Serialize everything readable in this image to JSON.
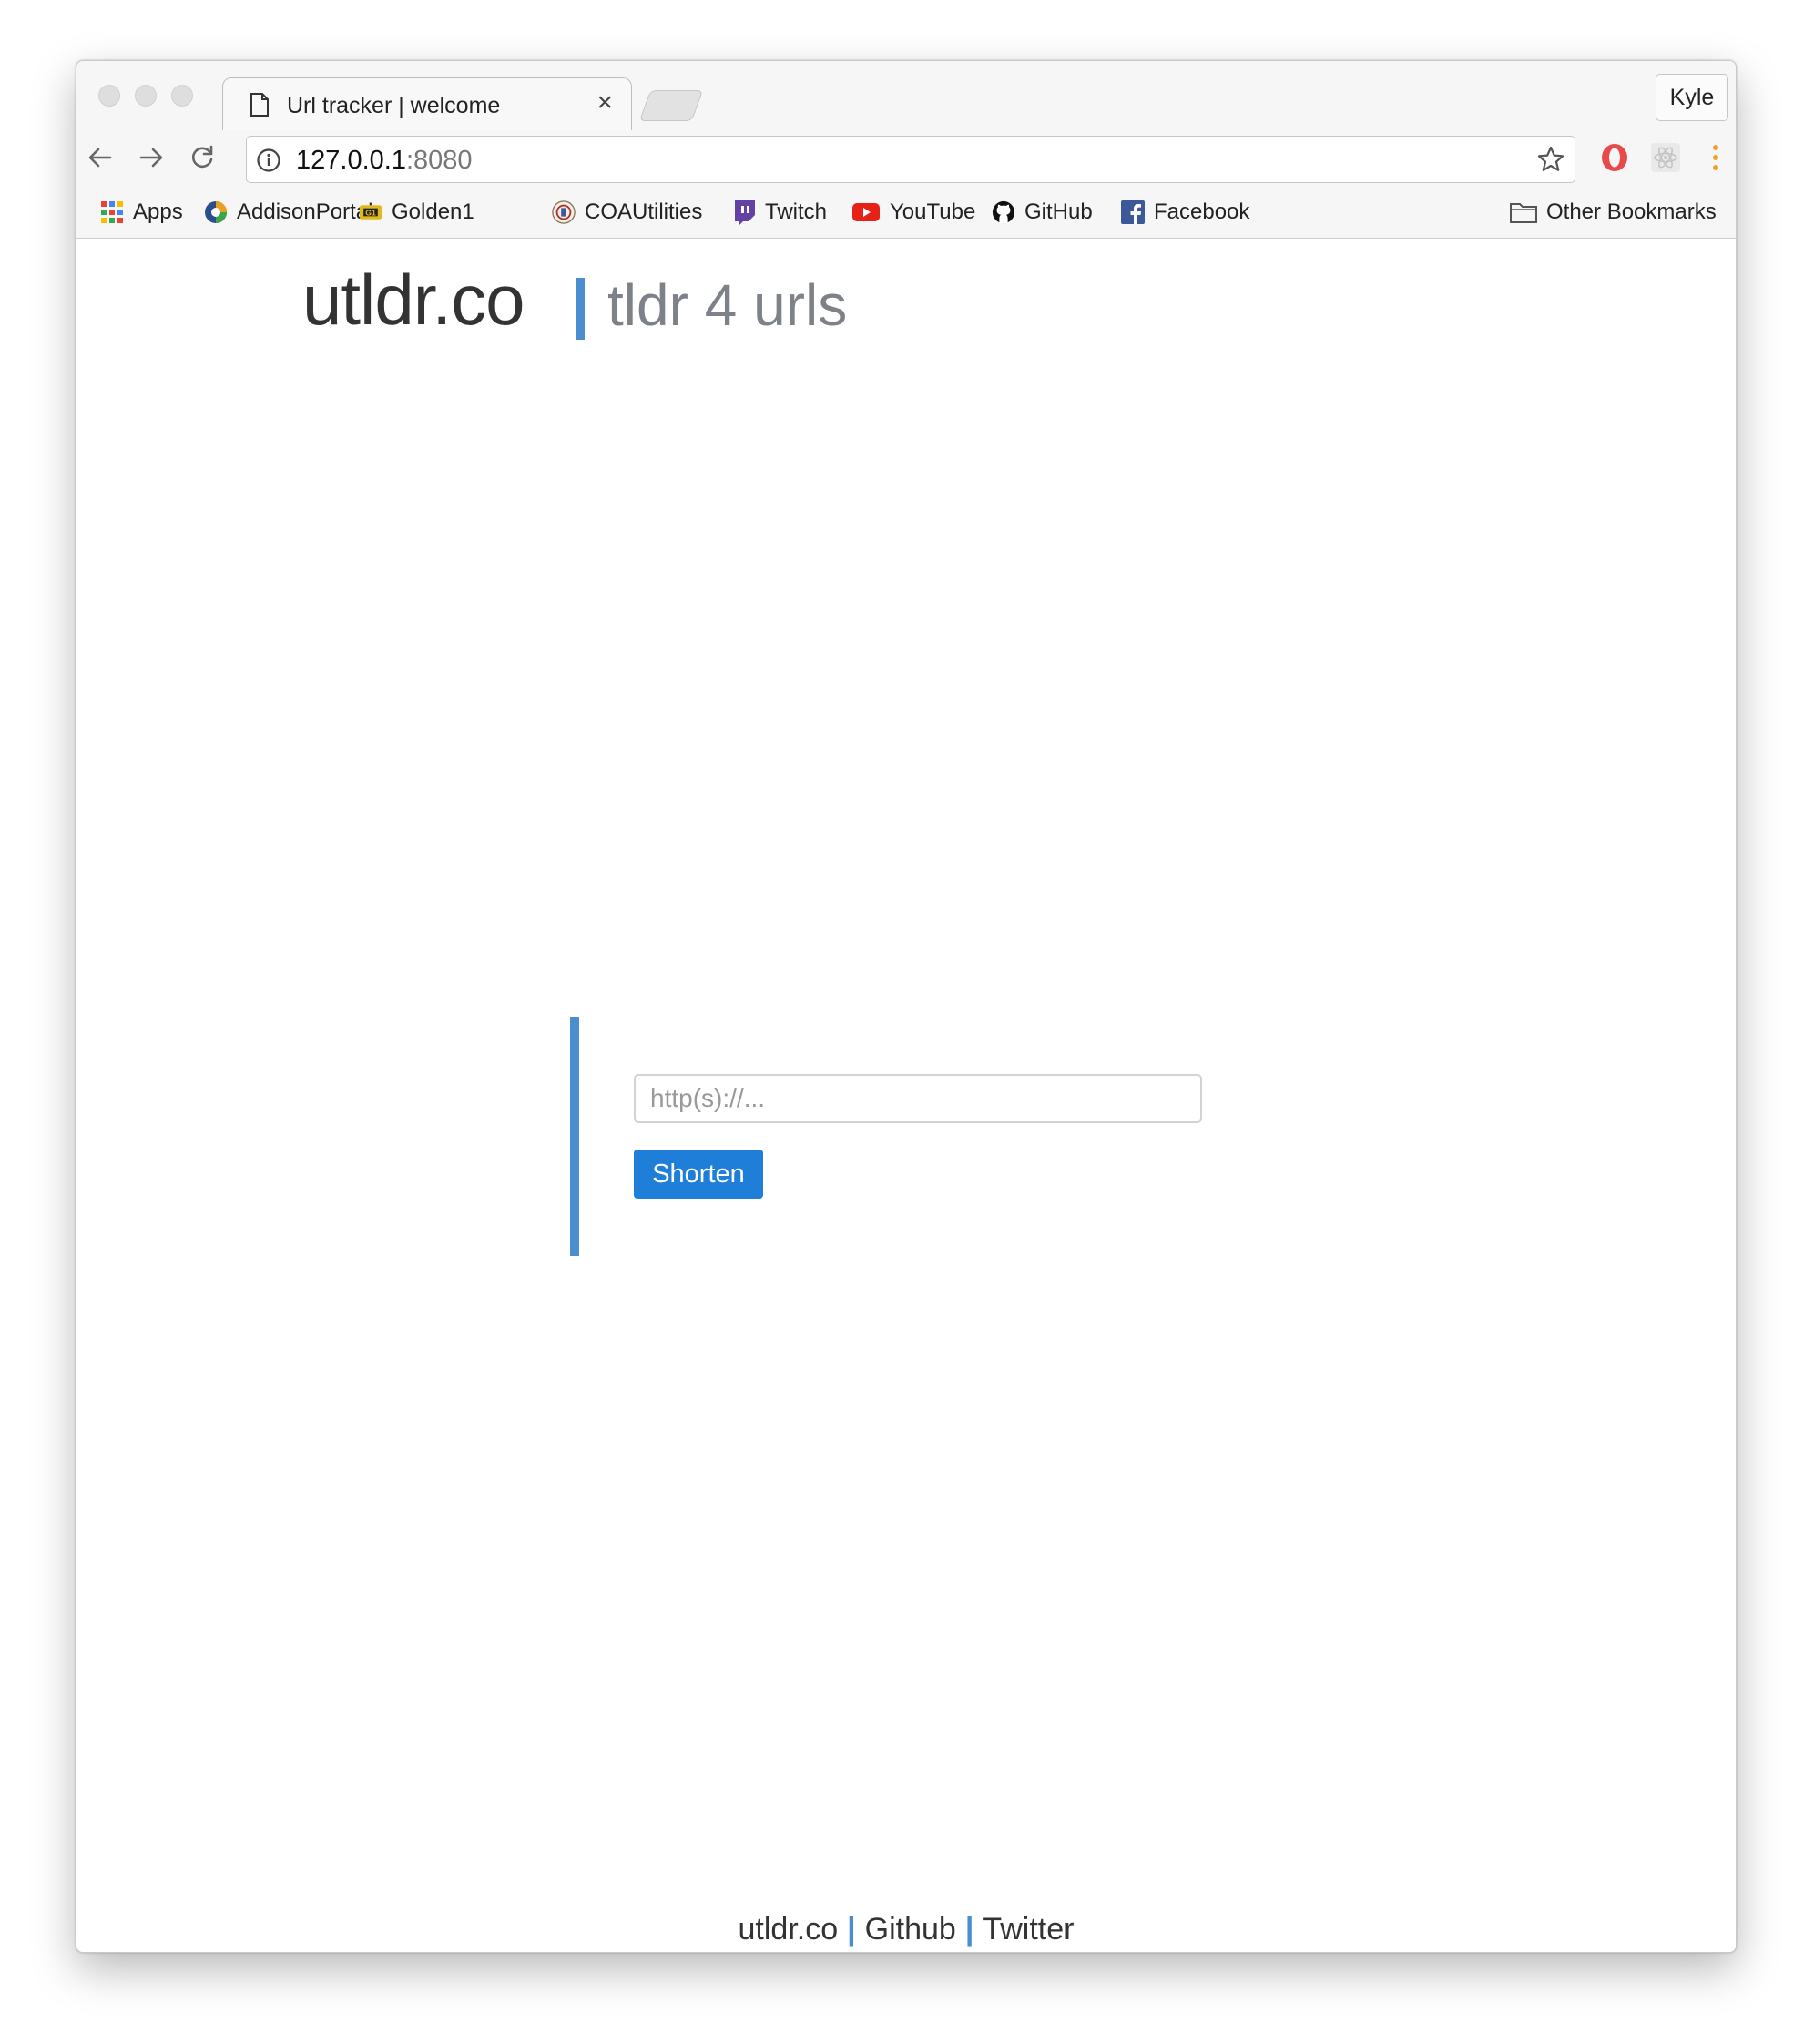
{
  "browser": {
    "tab": {
      "title": "Url tracker | welcome",
      "close_glyph": "×"
    },
    "profile": {
      "name": "Kyle"
    },
    "address": {
      "host": "127.0.0.1",
      "port": ":8080"
    },
    "bookmarks": [
      {
        "label": "Apps",
        "icon": "apps-grid-icon"
      },
      {
        "label": "AddisonPortal",
        "icon": "addison-portal-icon"
      },
      {
        "label": "Golden1",
        "icon": "golden1-icon"
      },
      {
        "label": "COAUtilities",
        "icon": "coa-seal-icon"
      },
      {
        "label": "Twitch",
        "icon": "twitch-icon"
      },
      {
        "label": "YouTube",
        "icon": "youtube-icon"
      },
      {
        "label": "GitHub",
        "icon": "github-icon"
      },
      {
        "label": "Facebook",
        "icon": "facebook-icon"
      }
    ],
    "other_bookmarks": "Other Bookmarks"
  },
  "page": {
    "brand": "utldr.co",
    "tagline": "tldr 4 urls",
    "form": {
      "placeholder": "http(s)://...",
      "submit_label": "Shorten"
    },
    "footer": {
      "links": [
        "utldr.co",
        "Github",
        "Twitter"
      ],
      "separator": "|"
    }
  },
  "colors": {
    "accent": "#4a8ed0",
    "button": "#1f7fd8",
    "brand_text": "#333333",
    "tagline_text": "#7d8288"
  }
}
